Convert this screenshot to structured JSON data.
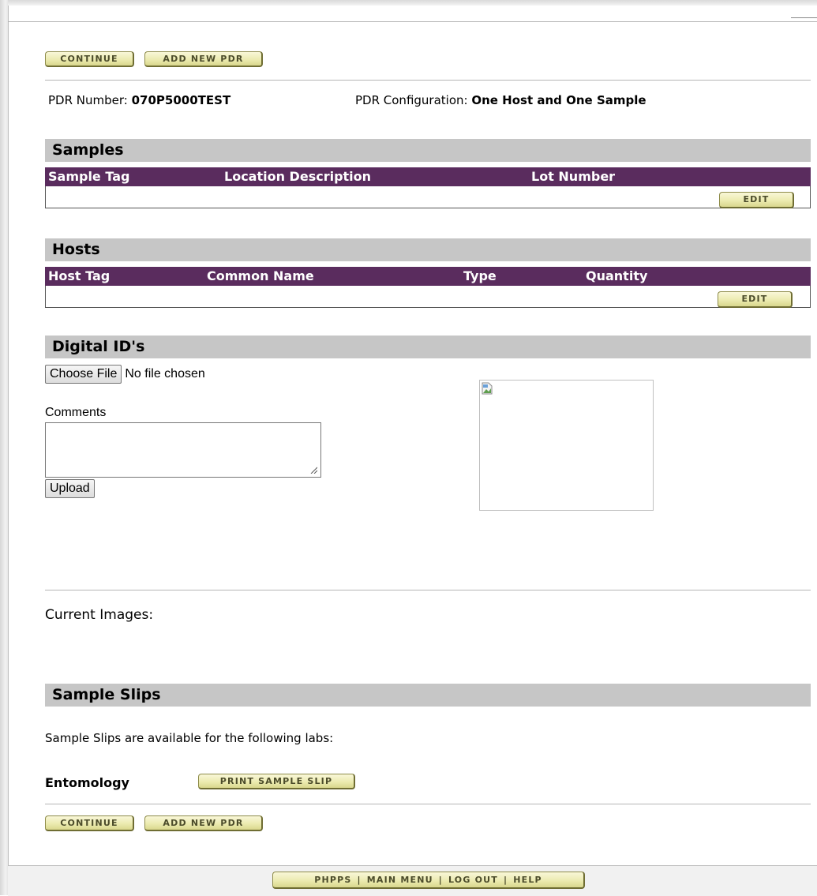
{
  "top_actions": {
    "continue": "CONTINUE",
    "add_new_pdr": "ADD NEW PDR"
  },
  "pdr": {
    "number_label": "PDR Number:",
    "number_value": "070P5000TEST",
    "config_label": "PDR Configuration:",
    "config_value": "One Host and One Sample"
  },
  "samples": {
    "title": "Samples",
    "columns": [
      "Sample Tag",
      "Location Description",
      "Lot Number"
    ],
    "edit": "EDIT"
  },
  "hosts": {
    "title": "Hosts",
    "columns": [
      "Host Tag",
      "Common Name",
      "Type",
      "Quantity"
    ],
    "edit": "EDIT"
  },
  "digital_ids": {
    "title": "Digital ID's",
    "choose_file": "Choose File",
    "no_file": "No file chosen",
    "comments_label": "Comments",
    "comments_value": "",
    "upload": "Upload",
    "current_images": "Current Images:"
  },
  "sample_slips": {
    "title": "Sample Slips",
    "intro": "Sample Slips are available for the following labs:",
    "lab": "Entomology",
    "print": "PRINT SAMPLE SLIP"
  },
  "bottom_actions": {
    "continue": "CONTINUE",
    "add_new_pdr": "ADD NEW PDR"
  },
  "footer": {
    "items": [
      "PHPPS",
      "MAIN MENU",
      "LOG OUT",
      "HELP"
    ],
    "separator": "|"
  },
  "colors": {
    "table_header": "#5a2c5e",
    "section_header": "#c6c6c6",
    "button_face": "#ecebb1"
  }
}
